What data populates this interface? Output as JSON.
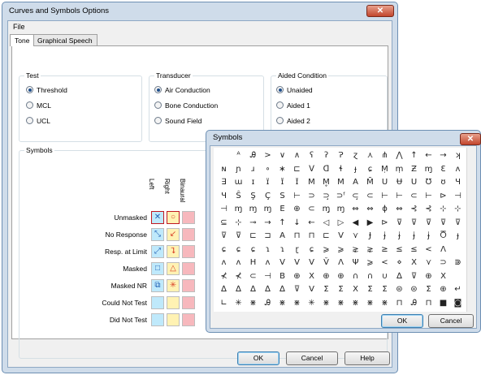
{
  "main_window": {
    "title": "Curves and Symbols Options",
    "close_glyph": "✕"
  },
  "menu": {
    "file": "File"
  },
  "tabs": [
    {
      "label": "Tone"
    },
    {
      "label": "Graphical Speech"
    }
  ],
  "test": {
    "title": "Test",
    "options": [
      "Threshold",
      "MCL",
      "UCL"
    ],
    "selected": "Threshold"
  },
  "transducer": {
    "title": "Transducer",
    "options": [
      "Air Conduction",
      "Bone Conduction",
      "Sound Field"
    ],
    "selected": "Air Conduction"
  },
  "aided": {
    "title": "Aided Condition",
    "options": [
      "Unaided",
      "Aided 1",
      "Aided 2"
    ],
    "selected": "Unaided"
  },
  "symbols_group": {
    "title": "Symbols",
    "columns": [
      "Left",
      "Right",
      "Binaural"
    ],
    "rows": [
      {
        "label": "Unmasked",
        "left": "✕",
        "right": "○"
      },
      {
        "label": "No Response",
        "left": "⤡",
        "right": "↙"
      },
      {
        "label": "Resp. at Limit",
        "left": "⤢",
        "right": "⮧"
      },
      {
        "label": "Masked",
        "left": "□",
        "right": "△"
      },
      {
        "label": "Masked NR",
        "left": "⧉",
        "right": "✳"
      },
      {
        "label": "Could Not Test",
        "left": "",
        "right": ""
      },
      {
        "label": "Did Not Test",
        "left": "",
        "right": ""
      }
    ],
    "colors": {
      "left": "#bfe9fb",
      "right": "#fff2b3",
      "binaural": "#f7b8bd",
      "left_glyph": "#1f5fb5",
      "right_glyph": "#d9452b",
      "selected_border": "#c01820"
    }
  },
  "buttons": {
    "ok": "OK",
    "cancel": "Cancel",
    "help": "Help"
  },
  "symbols_window": {
    "title": "Symbols",
    "close_glyph": "✕",
    "ok": "OK",
    "cancel": "Cancel",
    "rows": [
      [
        "",
        "ᴬ",
        "Ꭿ",
        ">",
        "∨",
        "∧",
        "ʕ",
        "ʔ",
        "Ɂ",
        "ɀ",
        "⋏",
        "⋔",
        "⋀",
        "↑",
        "←",
        "→",
        "ʞ"
      ],
      [
        "ɴ",
        "ɲ",
        "ɹ",
        "∘",
        "∗",
        "⊏",
        "ᐯ",
        "ꓷ",
        "ɬ",
        "ɟ",
        "ɕ",
        "Ṃ",
        "ṃ",
        "Ƶ",
        "ɱ",
        "Ɛ",
        "ᴧ"
      ],
      [
        "∃",
        "ɯ",
        "ɪ",
        "ɪ̈",
        "ɪ̆",
        "ɪ̌",
        "M",
        "M̥",
        "M",
        "A",
        "M̃",
        "U",
        "Ʉ",
        "U",
        "Ʊ",
        "ʊ",
        "Ɥ"
      ],
      [
        "Ɥ",
        "Ŝ",
        "Ş",
        "Ç",
        "S",
        "⊢",
        "⊃",
        "⊃̧",
        "⊃ᶠ",
        "⊂̧",
        "⊂",
        "⊢",
        "⊢",
        "⊂",
        "⊢",
        "⊳",
        "⊣"
      ],
      [
        "⊣",
        "ɱ",
        "ɱ",
        "ɱ",
        "E",
        "⊕",
        "⊂",
        "ɱ̧",
        "ɱ",
        "⇔",
        "⇔",
        "ɸ",
        "⇔",
        "⊰",
        "⊰",
        "⊹",
        "⊹"
      ],
      [
        "⊆",
        "⊹",
        "⊸",
        "→",
        "↑",
        "↓",
        "←",
        "◁",
        "▷",
        "◀",
        "▶",
        "⊳",
        "⊽",
        "⊽",
        "⊽̈",
        "⊽",
        "⊽"
      ],
      [
        "⊽",
        "⊽",
        "⊏",
        "⊐",
        "A",
        "⊓",
        "⊓",
        "⊏",
        "V",
        "⋎",
        "Ɉ",
        "ɉ",
        "ɉ",
        "ɉ",
        "ɉ",
        "Ⴃ",
        "ɟ"
      ],
      [
        "ɕ",
        "ɕ",
        "ɕ",
        "ɿ",
        "ɿ",
        "ɽ",
        "ɕ",
        "⩾",
        "⩾",
        "⋧",
        "⋧",
        "≥",
        "≤",
        "≤",
        "<",
        "Ʌ"
      ],
      [
        "ʌ",
        "ʌ",
        "H",
        "ᴧ",
        "V",
        "V",
        "V",
        "V̌",
        "Ʌ",
        "Ψ",
        "⩾",
        "<",
        "⋄",
        "X",
        "⋎",
        "⊃",
        "⋑"
      ],
      [
        "⊀",
        "⊀",
        "⊂",
        "⊣",
        "B",
        "⊕",
        "X",
        "⊕",
        "⊕",
        "∩",
        "∩",
        "∪",
        "∆",
        "⊽",
        "⊕",
        "X"
      ],
      [
        "∆",
        "∆",
        "∆",
        "∆",
        "∆",
        "⊽",
        "V",
        "Σ",
        "Σ",
        "X",
        "Σ",
        "Σ",
        "⊜",
        "⊜",
        "Σ",
        "⊕",
        "↵"
      ],
      [
        "∟",
        "✳",
        "⋇",
        "Ꭿ",
        "⋇",
        "⋇",
        "✳",
        "⋇",
        "⋇",
        "⋇",
        "⋇",
        "⋇",
        "⊓",
        "Ꭿ",
        "⊓",
        "■",
        "◙"
      ]
    ]
  }
}
